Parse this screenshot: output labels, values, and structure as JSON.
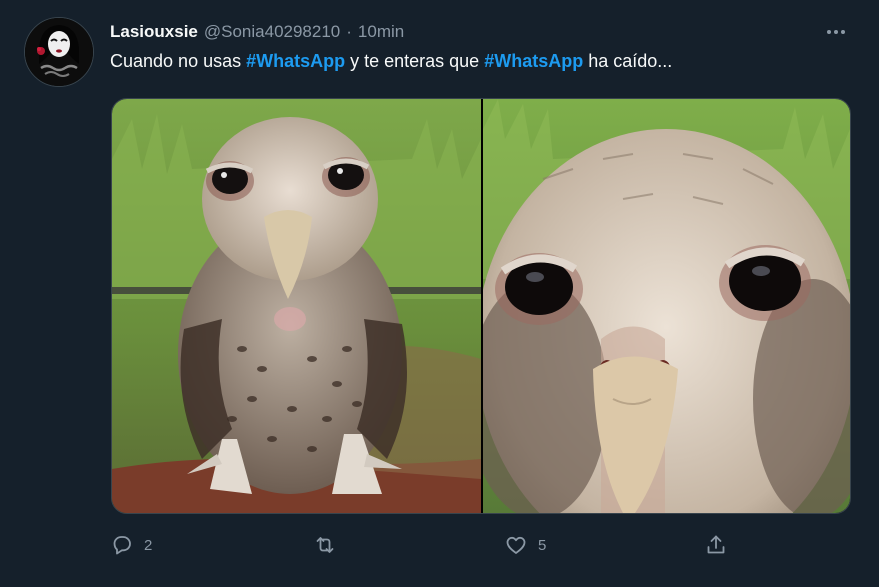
{
  "tweet": {
    "author_name": "Lasiouxsie",
    "author_handle": "@Sonia40298210",
    "separator": "·",
    "time": "10min",
    "text_parts": [
      "Cuando no usas ",
      "#WhatsApp",
      " y te enteras que ",
      "#WhatsApp",
      " ha caído..."
    ],
    "media_icons": [
      "owl-photo-icon",
      "owl-closeup-photo-icon"
    ]
  },
  "actions": {
    "reply_count": "2",
    "retweet_count": "",
    "like_count": "5",
    "icons": [
      "reply-icon",
      "retweet-icon",
      "like-icon",
      "share-icon"
    ]
  },
  "colors": {
    "background": "#15202b",
    "accent": "#1d9bf0",
    "secondary_text": "#8b98a5"
  }
}
